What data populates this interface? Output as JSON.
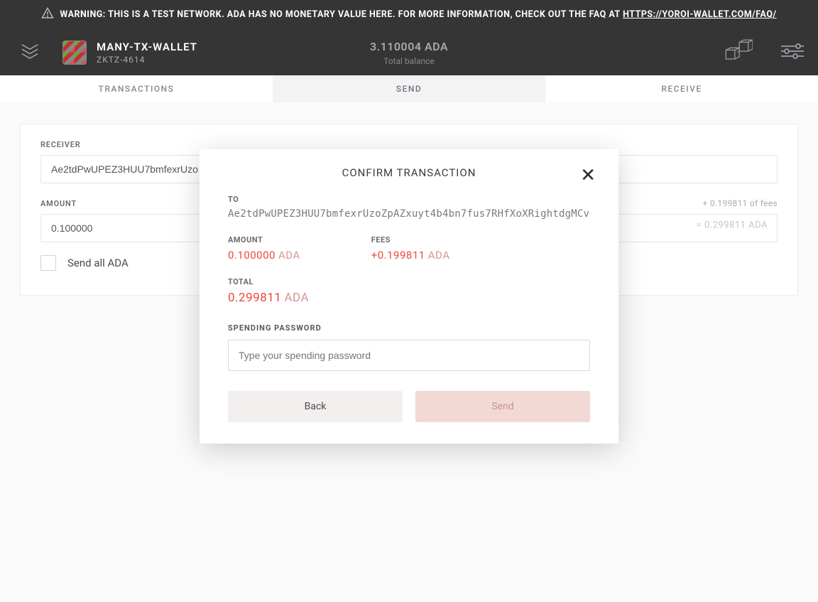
{
  "warning": {
    "text": "WARNING: THIS IS A TEST NETWORK. ADA HAS NO MONETARY VALUE HERE. FOR MORE INFORMATION, CHECK OUT THE FAQ AT ",
    "link_text": "HTTPS://YOROI-WALLET.COM/FAQ/"
  },
  "header": {
    "wallet_name": "MANY-TX-WALLET",
    "wallet_sub": "ZKTZ-4614",
    "balance_value": "3.110004 ADA",
    "balance_label": "Total balance"
  },
  "tabs": {
    "transactions": "TRANSACTIONS",
    "send": "SEND",
    "receive": "RECEIVE"
  },
  "form": {
    "receiver_label": "RECEIVER",
    "receiver_value": "Ae2tdPwUPEZ3HUU7bmfexrUzo",
    "amount_label": "AMOUNT",
    "amount_value": "0.100000",
    "fees_hint": "+ 0.199811 of fees",
    "amount_eq": "= 0.299811 ADA",
    "send_all_label": "Send all ADA"
  },
  "modal": {
    "title": "CONFIRM TRANSACTION",
    "to_label": "TO",
    "to_address": "Ae2tdPwUPEZ3HUU7bmfexrUzoZpAZxuyt4b4bn7fus7RHfXoXRightdgMCv",
    "amount_label": "AMOUNT",
    "amount_value": "0.100000",
    "amount_unit": "ADA",
    "fees_label": "FEES",
    "fees_value": "+0.199811",
    "fees_unit": "ADA",
    "total_label": "TOTAL",
    "total_value": "0.299811",
    "total_unit": "ADA",
    "password_label": "SPENDING PASSWORD",
    "password_placeholder": "Type your spending password",
    "back_label": "Back",
    "send_label": "Send"
  },
  "colors": {
    "accent_red": "#ef473a",
    "bg_dark": "#353535"
  }
}
